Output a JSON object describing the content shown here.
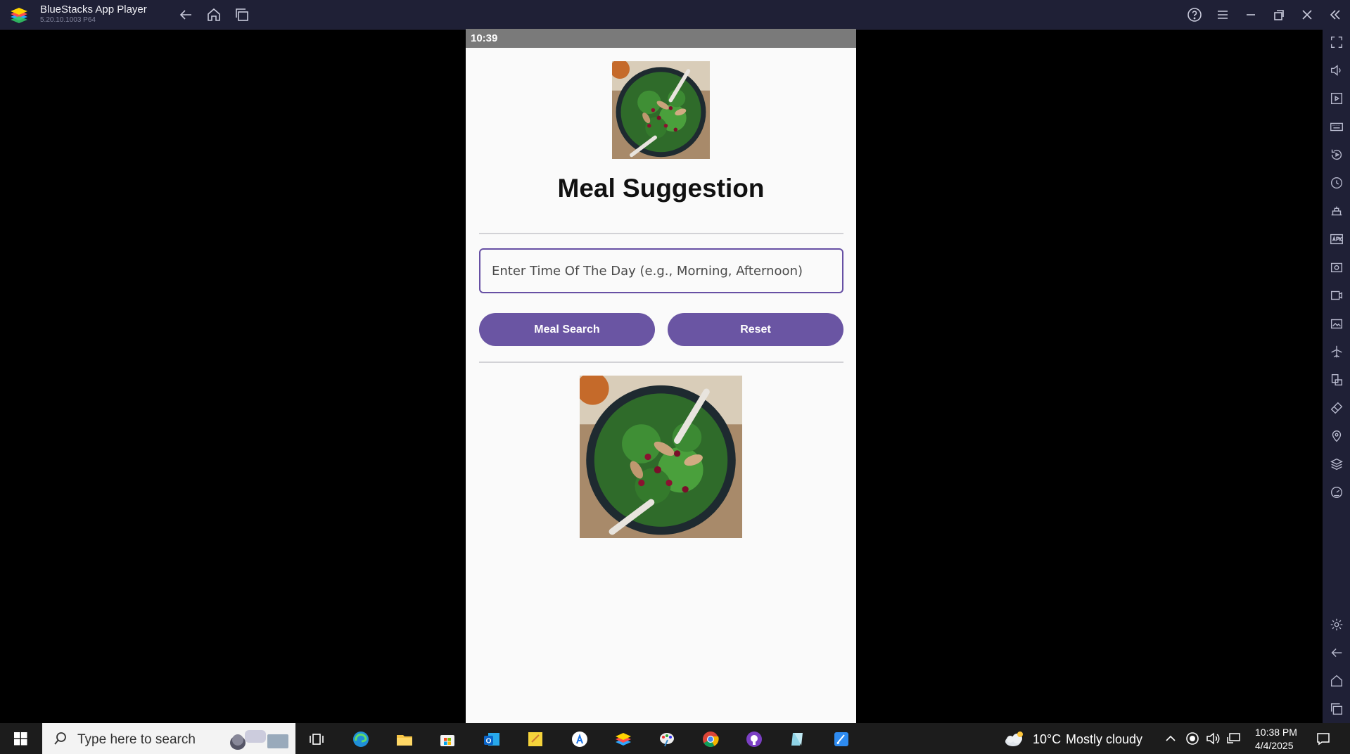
{
  "window": {
    "title": "BlueStacks App Player",
    "version": "5.20.10.1003  P64"
  },
  "phone": {
    "status_time": "10:39",
    "page_title": "Meal Suggestion",
    "input_placeholder": "Enter Time Of The Day (e.g., Morning, Afternoon)",
    "input_value": "",
    "search_button": "Meal Search",
    "reset_button": "Reset"
  },
  "taskbar": {
    "search_placeholder": "Type here to search",
    "weather_temp": "10°C",
    "weather_desc": "Mostly cloudy",
    "clock_time": "10:38 PM",
    "clock_date": "4/4/2025"
  },
  "icons": {
    "titlebar": [
      "back-icon",
      "home-icon",
      "recent-apps-icon",
      "help-icon",
      "menu-icon",
      "minimize-icon",
      "restore-icon",
      "close-icon",
      "collapse-sidebar-icon"
    ],
    "sidebar": [
      "fullscreen-icon",
      "volume-icon",
      "media-icon",
      "keyboard-icon",
      "rotate-icon",
      "sync-icon",
      "macro-icon",
      "apk-icon",
      "screenshot-icon",
      "record-icon",
      "folder-icon",
      "airplane-icon",
      "multi-instance-icon",
      "eco-mode-icon",
      "location-icon",
      "layers-icon",
      "performance-icon",
      "settings-icon",
      "android-back-icon",
      "android-home-icon",
      "android-recent-icon"
    ]
  },
  "colors": {
    "accent": "#6750a4",
    "button": "#6a55a3",
    "titlebar": "#1f2036",
    "statusbar": "#7a7a7a"
  }
}
